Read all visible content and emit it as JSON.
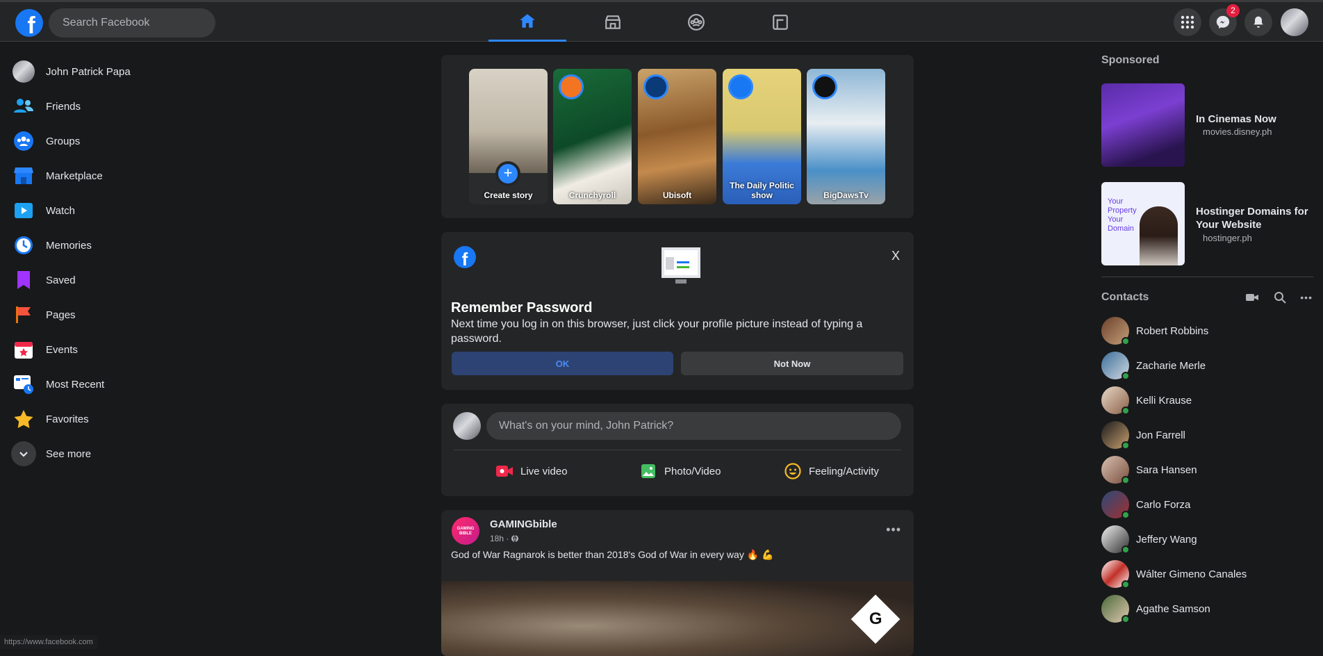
{
  "search": {
    "placeholder": "Search Facebook"
  },
  "nav_icons": [
    "home-icon",
    "marketplace-icon",
    "groups-icon",
    "gaming-icon"
  ],
  "header": {
    "messenger_badge": "2"
  },
  "left_nav": {
    "items": [
      {
        "label": "John Patrick Papa",
        "icon": "profile-avatar"
      },
      {
        "label": "Friends",
        "icon": "friends-icon"
      },
      {
        "label": "Groups",
        "icon": "groups-icon"
      },
      {
        "label": "Marketplace",
        "icon": "marketplace-icon"
      },
      {
        "label": "Watch",
        "icon": "watch-icon"
      },
      {
        "label": "Memories",
        "icon": "memories-icon"
      },
      {
        "label": "Saved",
        "icon": "saved-icon"
      },
      {
        "label": "Pages",
        "icon": "pages-icon"
      },
      {
        "label": "Events",
        "icon": "events-icon"
      },
      {
        "label": "Most Recent",
        "icon": "most-recent-icon"
      },
      {
        "label": "Favorites",
        "icon": "favorites-icon"
      },
      {
        "label": "See more",
        "icon": "chevron-down-icon"
      }
    ]
  },
  "stories": [
    {
      "label": "Create story"
    },
    {
      "label": "Crunchyroll"
    },
    {
      "label": "Ubisoft"
    },
    {
      "label": "The Daily Politic show"
    },
    {
      "label": "BigDawsTv"
    }
  ],
  "remember_password": {
    "title": "Remember Password",
    "body": "Next time you log in on this browser, just click your profile picture instead of typing a password.",
    "ok": "OK",
    "not_now": "Not Now",
    "close": "X"
  },
  "composer": {
    "placeholder": "What's on your mind, John Patrick?",
    "live": "Live video",
    "photo": "Photo/Video",
    "feeling": "Feeling/Activity"
  },
  "post": {
    "author": "GAMINGbible",
    "time": "18h · ",
    "text": "God of War Ragnarok is better than 2018's God of War in every way 🔥 💪",
    "avatar_text": "GAMING BIBLE"
  },
  "sponsored": {
    "title": "Sponsored",
    "ads": [
      {
        "title": "In Cinemas Now",
        "domain": "movies.disney.ph"
      },
      {
        "title": "Hostinger Domains for Your Website",
        "domain": "hostinger.ph",
        "thumb_text": "Your Property Your Domain"
      }
    ]
  },
  "contacts": {
    "title": "Contacts",
    "list": [
      "Robert Robbins",
      "Zacharie Merle",
      "Kelli Krause",
      "Jon Farrell",
      "Sara Hansen",
      "Carlo Forza",
      "Jeffery Wang",
      "Wálter Gimeno Canales",
      "Agathe Samson"
    ]
  },
  "status_bar": {
    "url": "https://www.facebook.com"
  },
  "colors": {
    "accent": "#2d88ff",
    "online": "#31a24c",
    "badge": "#e41e3f"
  }
}
